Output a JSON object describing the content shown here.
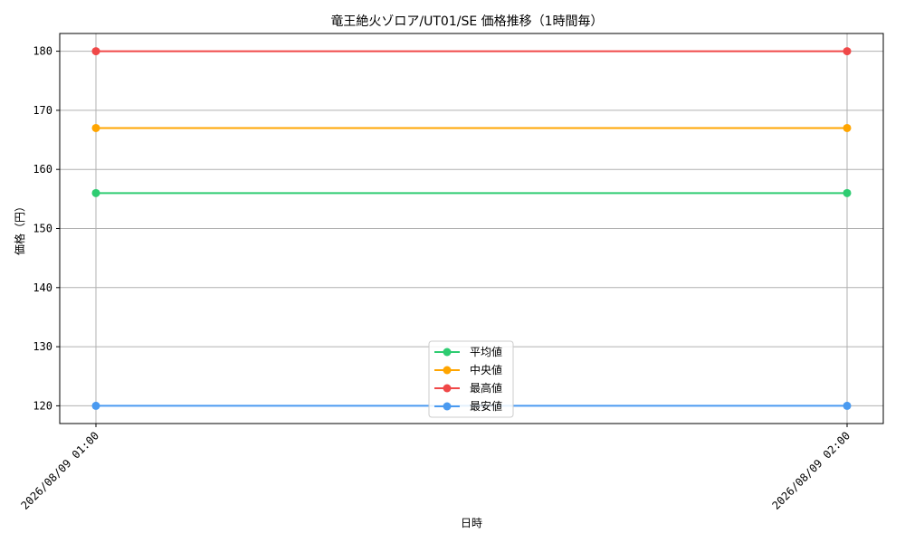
{
  "chart_data": {
    "type": "line",
    "title": "竜王絶火ゾロア/UT01/SE 価格推移（1時間毎）",
    "xlabel": "日時",
    "ylabel": "価格（円）",
    "x": [
      "2026/08/09 01:00",
      "2026/08/09 02:00"
    ],
    "ylim": [
      117,
      183
    ],
    "yticks": [
      120,
      130,
      140,
      150,
      160,
      170,
      180
    ],
    "grid": true,
    "legend_position": "bottom-center",
    "series": [
      {
        "name": "平均値",
        "values": [
          156,
          156
        ],
        "color": "#2ecc71"
      },
      {
        "name": "中央値",
        "values": [
          167,
          167
        ],
        "color": "#ffa500"
      },
      {
        "name": "最高値",
        "values": [
          180,
          180
        ],
        "color": "#f04848"
      },
      {
        "name": "最安値",
        "values": [
          120,
          120
        ],
        "color": "#4a9af0"
      }
    ]
  }
}
